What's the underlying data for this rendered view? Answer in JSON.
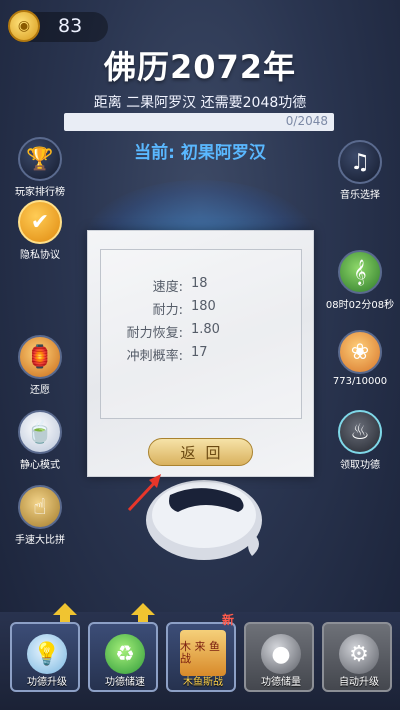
{
  "header": {
    "coins": "83",
    "year_title": "佛历2072年",
    "distance_text": "距离 二果阿罗汉 还需要2048功德",
    "progress": {
      "current": 0,
      "total": 2048,
      "label": "0/2048",
      "fraction": 0
    },
    "current_rank": "当前: 初果阿罗汉"
  },
  "left_buttons": [
    {
      "label": "玩家排行榜",
      "icon": "trophy-icon"
    },
    {
      "label": "隐私协议",
      "icon": "shield-icon"
    },
    {
      "label": "还愿",
      "icon": "lantern-icon"
    },
    {
      "label": "静心模式",
      "icon": "tea-cup-icon"
    },
    {
      "label": "手速大比拼",
      "icon": "tap-hand-icon"
    }
  ],
  "right_buttons": [
    {
      "label": "音乐选择",
      "icon": "music-note-icon"
    },
    {
      "label": "08时02分08秒",
      "icon": "flute-icon"
    },
    {
      "label": "773/10000",
      "icon": "lotus-lamp-icon"
    },
    {
      "label": "领取功德",
      "icon": "incense-burner-icon"
    }
  ],
  "dialog": {
    "stats": [
      {
        "key": "速度:",
        "value": "18"
      },
      {
        "key": "耐力:",
        "value": "180"
      },
      {
        "key": "耐力恢复:",
        "value": "1.80"
      },
      {
        "key": "冲刺概率:",
        "value": "17"
      }
    ],
    "back_label": "返回"
  },
  "bottom_tiles": [
    {
      "label": "功德升级",
      "icon": "light-bulb-icon",
      "style": "blue",
      "upgrade": true
    },
    {
      "label": "功德储速",
      "icon": "recycle-icon",
      "style": "blue",
      "upgrade": true
    },
    {
      "label": "木鱼斯战",
      "icon": "monk-battle-icon",
      "style": "blue",
      "upgrade": false,
      "badge": "新",
      "art_text": "木 来 鱼 战"
    },
    {
      "label": "功德储量",
      "icon": "sphere-icon",
      "style": "gray",
      "upgrade": false
    },
    {
      "label": "自动升级",
      "icon": "gear-icon",
      "style": "gray",
      "upgrade": false
    }
  ],
  "colors": {
    "accent_blue": "#4a7de0",
    "rank_blue": "#5ab8ff",
    "gold": "#d9b15e",
    "badge_red": "#ff5a4a"
  }
}
